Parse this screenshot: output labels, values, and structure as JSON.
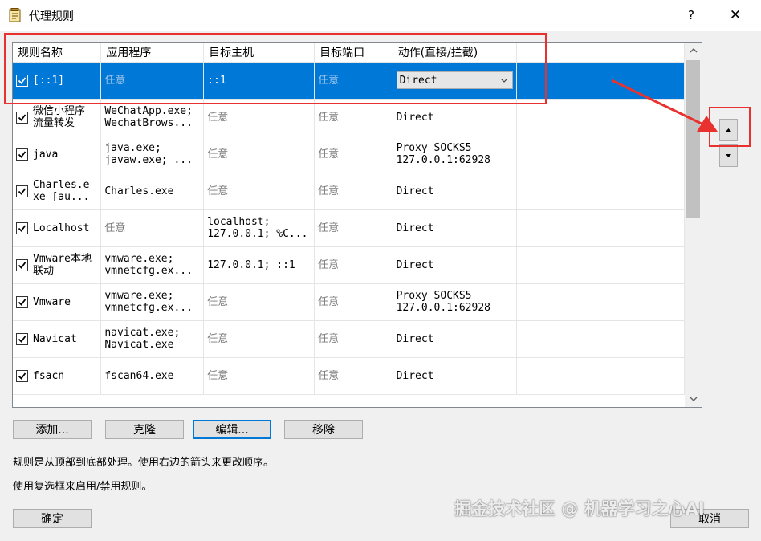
{
  "window": {
    "title": "代理规则",
    "help_label": "?",
    "close_label": "✕"
  },
  "table": {
    "columns": [
      "规则名称",
      "应用程序",
      "目标主机",
      "目标端口",
      "动作(直接/拦截)"
    ],
    "rows": [
      {
        "name": "[::1]",
        "app": "任意",
        "host": "::1",
        "port": "任意",
        "action": "Direct",
        "checked": true,
        "selected": true
      },
      {
        "name": "微信小程序\n流量转发",
        "app": "WeChatApp.exe;\nWechatBrows...",
        "host": "任意",
        "port": "任意",
        "action": "Direct",
        "checked": true
      },
      {
        "name": "java",
        "app": "java.exe;\njavaw.exe; ...",
        "host": "任意",
        "port": "任意",
        "action": "Proxy SOCKS5\n127.0.0.1:62928",
        "checked": true
      },
      {
        "name": "Charles.e\nxe [au...",
        "app": "Charles.exe",
        "host": "任意",
        "port": "任意",
        "action": "Direct",
        "checked": true
      },
      {
        "name": "Localhost",
        "app": "任意",
        "host": "localhost;\n127.0.0.1; %C...",
        "port": "任意",
        "action": "Direct",
        "checked": true
      },
      {
        "name": "Vmware本地\n联动",
        "app": "vmware.exe;\nvmnetcfg.ex...",
        "host": "127.0.0.1; ::1",
        "port": "任意",
        "action": "Direct",
        "checked": true
      },
      {
        "name": "Vmware",
        "app": "vmware.exe;\nvmnetcfg.ex...",
        "host": "任意",
        "port": "任意",
        "action": "Proxy SOCKS5\n127.0.0.1:62928",
        "checked": true
      },
      {
        "name": "Navicat",
        "app": "navicat.exe;\nNavicat.exe",
        "host": "任意",
        "port": "任意",
        "action": "Direct",
        "checked": true
      },
      {
        "name": "fsacn",
        "app": "fscan64.exe",
        "host": "任意",
        "port": "任意",
        "action": "Direct",
        "checked": true
      }
    ]
  },
  "buttons": {
    "add": "添加...",
    "clone": "克隆",
    "edit": "编辑...",
    "remove": "移除",
    "ok": "确定",
    "cancel": "取消"
  },
  "notes": {
    "order": "规则是从顶部到底部处理。使用右边的箭头来更改顺序。",
    "checkbox": "使用复选框来启用/禁用规则。"
  },
  "watermark": "掘金技术社区 @ 机器学习之心AI",
  "colors": {
    "selection": "#0078d7",
    "highlight": "#e8322f"
  },
  "icons": {
    "move_up": "triangle-up-icon",
    "move_down": "triangle-down-icon",
    "checkbox": "checkmark-icon"
  }
}
